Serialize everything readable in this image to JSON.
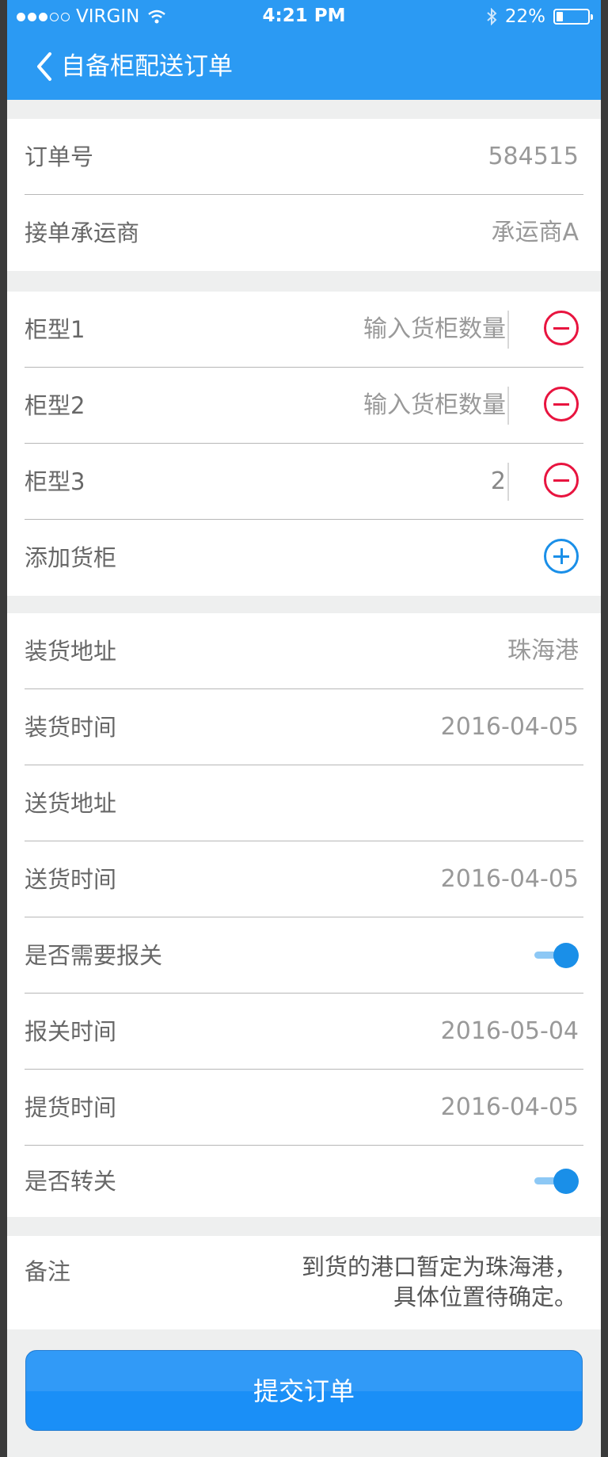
{
  "status_bar": {
    "carrier": "VIRGIN",
    "time": "4:21 PM",
    "battery": "22%",
    "battery_level": 0.22
  },
  "nav": {
    "title": "自备柜配送订单"
  },
  "order": {
    "order_no_label": "订单号",
    "order_no_value": "584515",
    "carrier_label": "接单承运商",
    "carrier_value": "承运商A"
  },
  "containers": {
    "items": [
      {
        "label": "柜型1",
        "qty_placeholder": "输入货柜数量",
        "qty": ""
      },
      {
        "label": "柜型2",
        "qty_placeholder": "输入货柜数量",
        "qty": ""
      },
      {
        "label": "柜型3",
        "qty_placeholder": "",
        "qty": "2"
      }
    ],
    "add_label": "添加货柜"
  },
  "details": {
    "load_address_label": "装货地址",
    "load_address_value": "珠海港",
    "load_time_label": "装货时间",
    "load_time_value": "2016-04-05",
    "delivery_address_label": "送货地址",
    "delivery_address_value": "",
    "delivery_time_label": "送货时间",
    "delivery_time_value": "2016-04-05",
    "customs_label": "是否需要报关",
    "customs_on": true,
    "customs_time_label": "报关时间",
    "customs_time_value": "2016-05-04",
    "pickup_time_label": "提货时间",
    "pickup_time_value": "2016-04-05",
    "transfer_label": "是否转关",
    "transfer_on": true
  },
  "remark": {
    "label": "备注",
    "value": "到货的港口暂定为珠海港，具体位置待确定。"
  },
  "submit_label": "提交订单",
  "colors": {
    "primary": "#2b9af3",
    "button": "#1a8ff7",
    "danger": "#e8143f",
    "background": "#eeefef",
    "text": "#676767",
    "muted": "#999999",
    "divider": "#b7b7b7"
  }
}
